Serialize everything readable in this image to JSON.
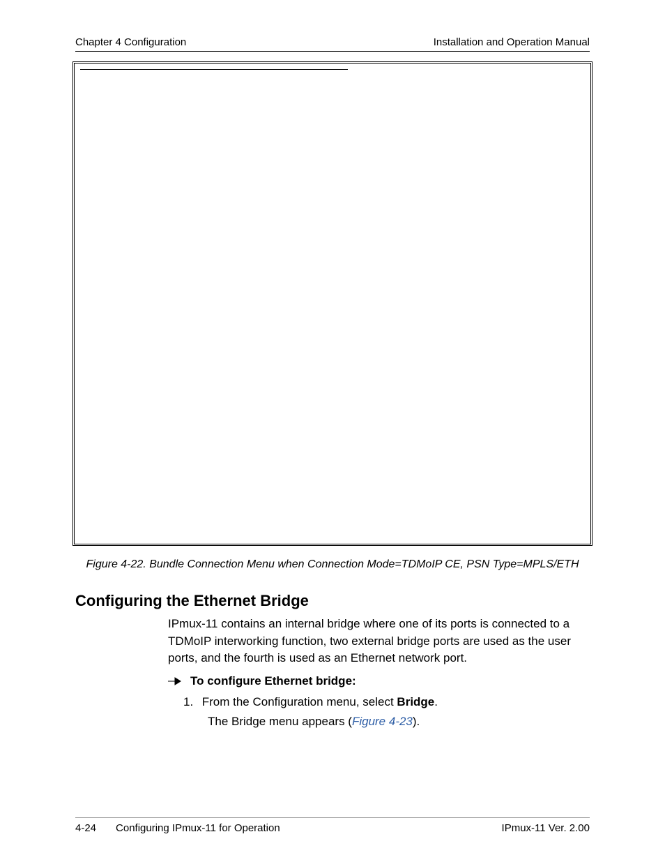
{
  "header": {
    "left": "Chapter 4  Configuration",
    "right": "Installation and Operation Manual"
  },
  "figure": {
    "caption": "Figure 4-22.  Bundle Connection Menu when Connection Mode=TDMoIP CE, PSN Type=MPLS/ETH"
  },
  "section": {
    "heading": "Configuring the Ethernet Bridge",
    "paragraph": "IPmux-11 contains an internal bridge where one of its ports is connected to a TDMoIP interworking function, two external bridge ports are used as the user ports, and the fourth is used as an Ethernet network port."
  },
  "procedure": {
    "title": "To configure Ethernet bridge:",
    "step_number": "1.",
    "step_text_prefix": "From the Configuration menu, select ",
    "step_text_bold": "Bridge",
    "step_text_suffix": ".",
    "result_prefix": "The Bridge menu appears (",
    "result_ref": "Figure 4-23",
    "result_suffix": ")."
  },
  "footer": {
    "page": "4-24",
    "section": "Configuring IPmux-11 for Operation",
    "right": "IPmux-11 Ver. 2.00"
  }
}
